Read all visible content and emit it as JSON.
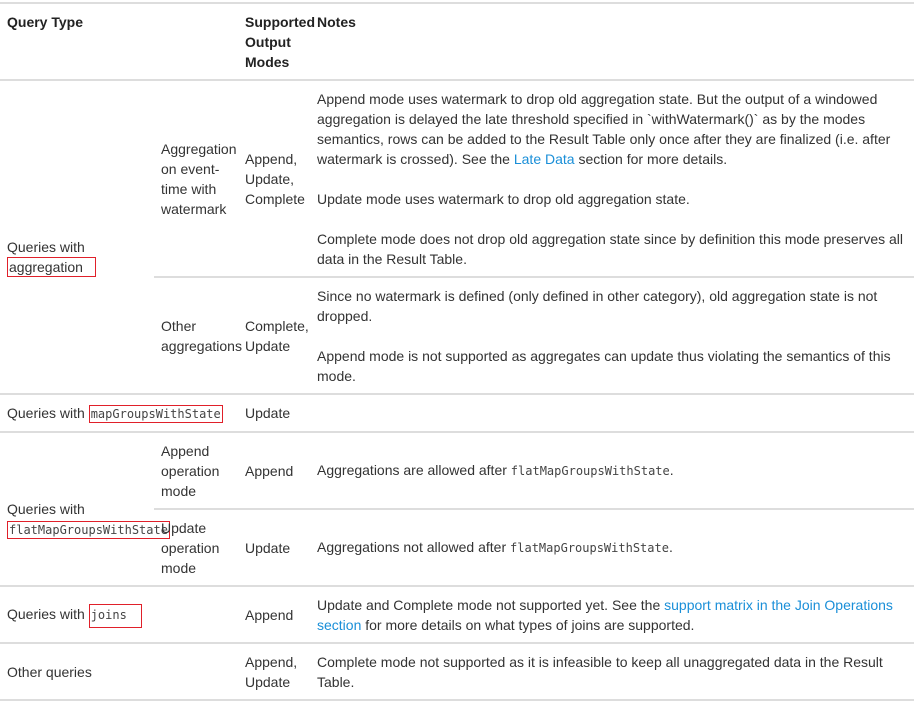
{
  "headers": {
    "query_type": "Query Type",
    "sub": "",
    "modes": "Supported Output Modes",
    "notes": "Notes"
  },
  "rows": {
    "aggregation": {
      "prefix": "Queries with",
      "keyword": "aggregation",
      "watermark": {
        "sub": "Aggregation on event-time with watermark",
        "modes": "Append, Update, Complete",
        "note1_a": "Append mode uses watermark to drop old aggregation state. But the output of a windowed aggregation is delayed the late threshold specified in `withWatermark()` as by the modes semantics, rows can be added to the Result Table only once after they are finalized (i.e. after watermark is crossed). See the ",
        "note1_link": "Late Data",
        "note1_b": " section for more details.",
        "note2": "Update mode uses watermark to drop old aggregation state.",
        "note3": "Complete mode does not drop old aggregation state since by definition this mode preserves all data in the Result Table."
      },
      "other": {
        "sub": "Other aggregations",
        "modes": "Complete, Update",
        "note1": "Since no watermark is defined (only defined in other category), old aggregation state is not dropped.",
        "note2": "Append mode is not supported as aggregates can update thus violating the semantics of this mode."
      }
    },
    "map": {
      "prefix": "Queries with",
      "keyword": "mapGroupsWithState",
      "modes": "Update"
    },
    "flatmap": {
      "prefix": "Queries with",
      "keyword": "flatMapGroupsWithState",
      "append": {
        "sub": "Append operation mode",
        "modes": "Append",
        "note": "Aggregations are allowed after ",
        "code": "flatMapGroupsWithState",
        "end": "."
      },
      "update": {
        "sub": "Update operation mode",
        "modes": "Update",
        "note": "Aggregations not allowed after ",
        "code": "flatMapGroupsWithState",
        "end": "."
      }
    },
    "joins": {
      "prefix": "Queries with",
      "keyword": "joins",
      "modes": "Append",
      "note_a": "Update and Complete mode not supported yet. See the ",
      "note_link": "support matrix in the Join Operations section",
      "note_b": " for more details on what types of joins are supported."
    },
    "other": {
      "label": "Other queries",
      "modes": "Append, Update",
      "note": "Complete mode not supported as it is infeasible to keep all unaggregated data in the Result Table."
    }
  }
}
